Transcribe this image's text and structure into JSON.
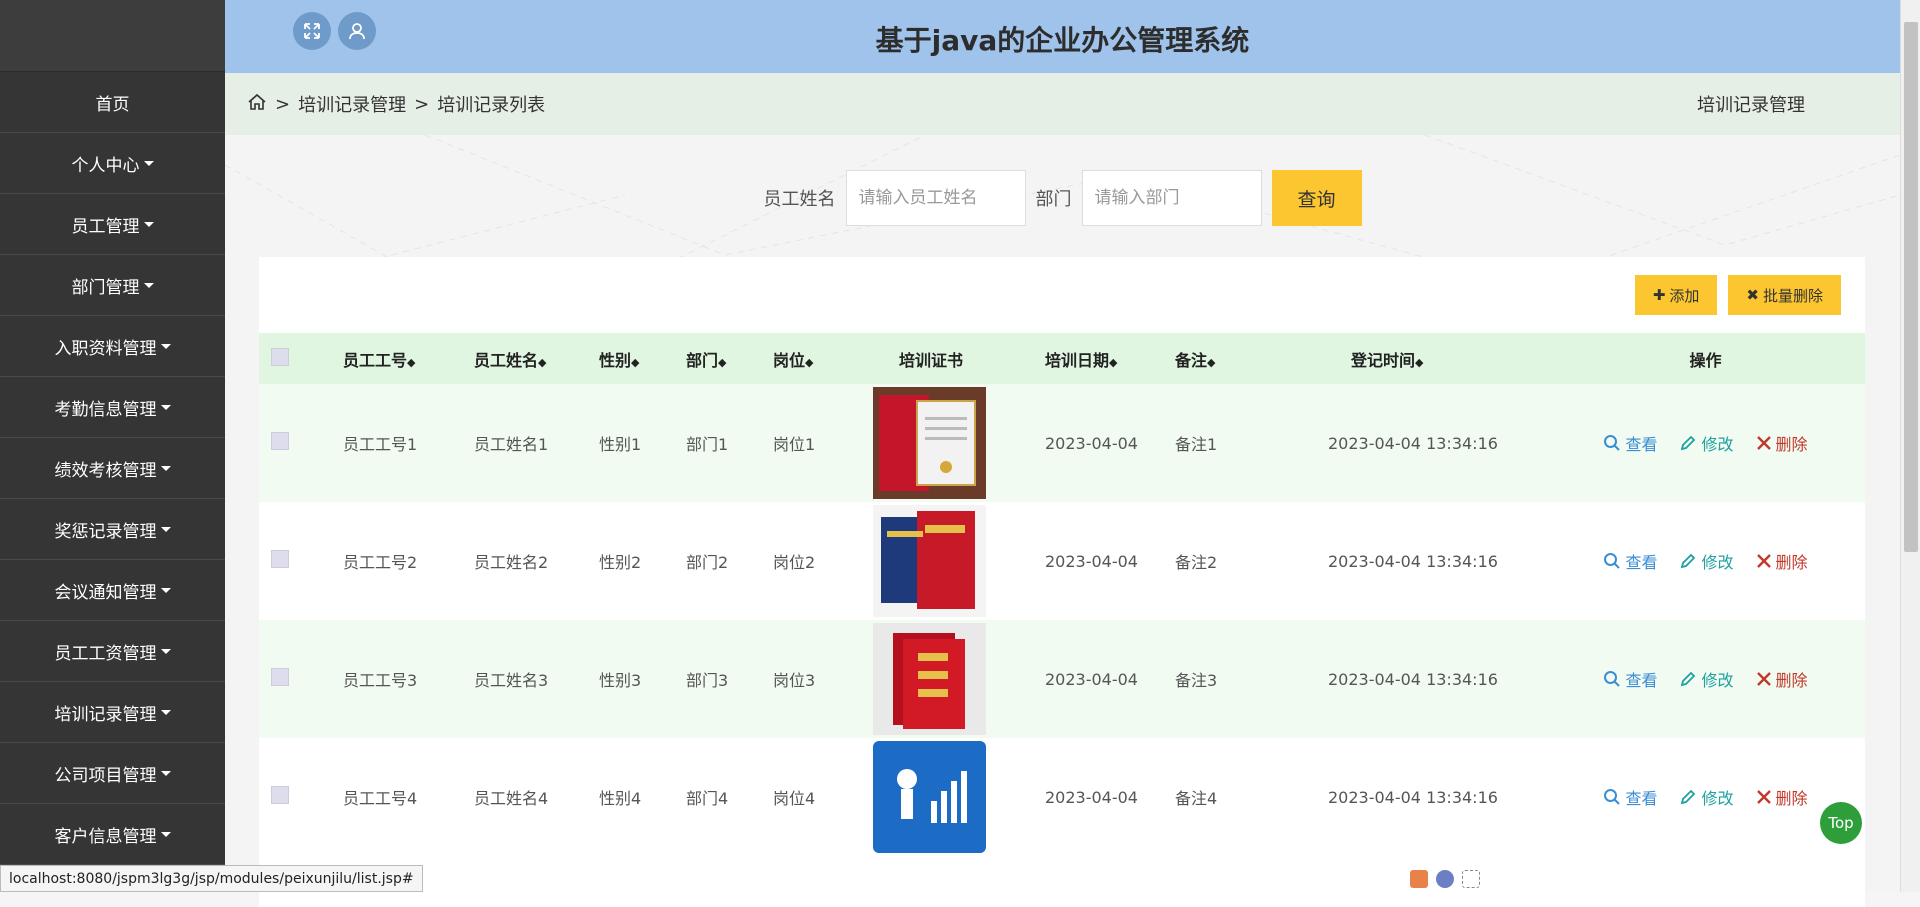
{
  "app": {
    "title": "基于java的企业办公管理系统"
  },
  "sidebar": {
    "items": [
      {
        "label": "首页",
        "dropdown": false
      },
      {
        "label": "个人中心",
        "dropdown": true
      },
      {
        "label": "员工管理",
        "dropdown": true
      },
      {
        "label": "部门管理",
        "dropdown": true
      },
      {
        "label": "入职资料管理",
        "dropdown": true
      },
      {
        "label": "考勤信息管理",
        "dropdown": true
      },
      {
        "label": "绩效考核管理",
        "dropdown": true
      },
      {
        "label": "奖惩记录管理",
        "dropdown": true
      },
      {
        "label": "会议通知管理",
        "dropdown": true
      },
      {
        "label": "员工工资管理",
        "dropdown": true
      },
      {
        "label": "培训记录管理",
        "dropdown": true
      },
      {
        "label": "公司项目管理",
        "dropdown": true
      },
      {
        "label": "客户信息管理",
        "dropdown": true
      }
    ]
  },
  "breadcrumb": {
    "sep": ">",
    "items": [
      "培训记录管理",
      "培训记录列表"
    ],
    "right": "培训记录管理"
  },
  "search": {
    "name_label": "员工姓名",
    "name_placeholder": "请输入员工姓名",
    "dept_label": "部门",
    "dept_placeholder": "请输入部门",
    "query_label": "查询"
  },
  "actions": {
    "add_label": "添加",
    "batch_delete_label": "批量删除"
  },
  "table": {
    "headers": [
      "员工工号",
      "员工姓名",
      "性别",
      "部门",
      "岗位",
      "培训证书",
      "培训日期",
      "备注",
      "登记时间",
      "操作"
    ],
    "rows": [
      {
        "emp_no": "员工工号1",
        "name": "员工姓名1",
        "gender": "性别1",
        "dept": "部门1",
        "post": "岗位1",
        "cert": "red-certificate",
        "date": "2023-04-04",
        "remark": "备注1",
        "time": "2023-04-04 13:34:16"
      },
      {
        "emp_no": "员工工号2",
        "name": "员工姓名2",
        "gender": "性别2",
        "dept": "部门2",
        "post": "岗位2",
        "cert": "graduation-certificate",
        "date": "2023-04-04",
        "remark": "备注2",
        "time": "2023-04-04 13:34:16"
      },
      {
        "emp_no": "员工工号3",
        "name": "员工姓名3",
        "gender": "性别3",
        "dept": "部门3",
        "post": "岗位3",
        "cert": "honor-certificate",
        "date": "2023-04-04",
        "remark": "备注3",
        "time": "2023-04-04 13:34:16"
      },
      {
        "emp_no": "员工工号4",
        "name": "员工姓名4",
        "gender": "性别4",
        "dept": "部门4",
        "post": "岗位4",
        "cert": "accountant-certificate",
        "date": "2023-04-04",
        "remark": "备注4",
        "time": "2023-04-04 13:34:16"
      }
    ],
    "ops": {
      "view": "查看",
      "edit": "修改",
      "delete": "删除"
    }
  },
  "status_url": "localhost:8080/jspm3lg3g/jsp/modules/peixunjilu/list.jsp#",
  "top_button": "Top",
  "colors": {
    "sidebar": "#353535",
    "header": "#9fc3ea",
    "accent": "#fbc62f",
    "table_head": "#e1f6e1"
  }
}
